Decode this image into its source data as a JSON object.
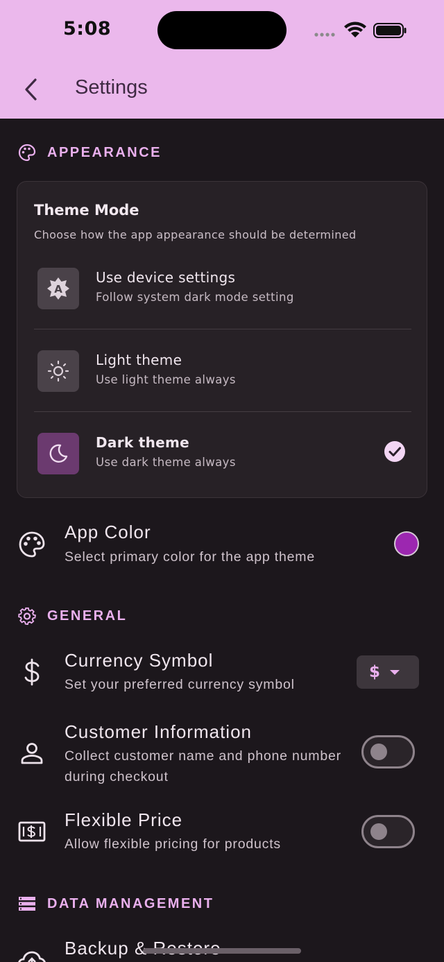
{
  "status_bar": {
    "time": "5:08"
  },
  "header": {
    "title": "Settings"
  },
  "appearance": {
    "section_label": "APPEARANCE",
    "theme_card": {
      "title": "Theme Mode",
      "subtitle": "Choose how the app appearance should be determined",
      "options": [
        {
          "label": "Use device settings",
          "description": "Follow system dark mode setting",
          "icon": "auto-brightness-icon",
          "selected": false
        },
        {
          "label": "Light theme",
          "description": "Use light theme always",
          "icon": "sun-icon",
          "selected": false
        },
        {
          "label": "Dark theme",
          "description": "Use dark theme always",
          "icon": "moon-icon",
          "selected": true
        }
      ]
    },
    "app_color": {
      "title": "App Color",
      "description": "Select primary color for the app theme",
      "value": "#9c27b0"
    }
  },
  "general": {
    "section_label": "GENERAL",
    "currency": {
      "title": "Currency Symbol",
      "description": "Set your preferred currency symbol",
      "value": "$"
    },
    "customer_info": {
      "title": "Customer Information",
      "description": "Collect customer name and phone number during checkout",
      "enabled": false
    },
    "flexible_price": {
      "title": "Flexible Price",
      "description": "Allow flexible pricing for products",
      "enabled": false
    }
  },
  "data_management": {
    "section_label": "DATA MANAGEMENT",
    "backup": {
      "title": "Backup & Restore"
    }
  },
  "colors": {
    "app_bar": "#ebb8ec",
    "background": "#1c171c",
    "accent": "#eab0ee",
    "primary": "#9c27b0"
  }
}
